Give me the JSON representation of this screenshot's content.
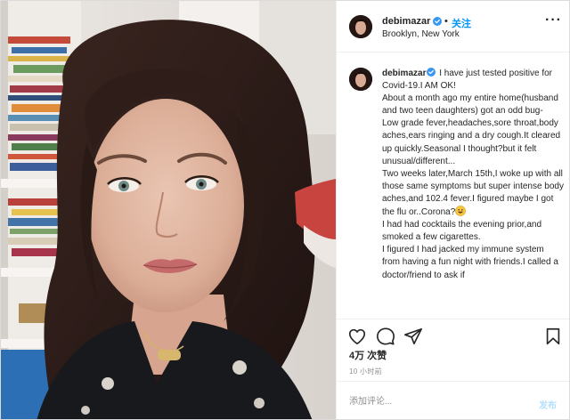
{
  "post": {
    "username": "debimazar",
    "follow_dot": "•",
    "follow_label": "关注",
    "location": "Brooklyn, New York",
    "more_label": "···",
    "caption_lines": [
      "I have just tested positive for Covid-19.I AM OK!",
      "About a month ago my entire home(husband and two teen daughters) got an odd bug-",
      "Low grade fever,headaches,sore throat,body aches,ears ringing and a dry cough.It cleared up quickly.Seasonal I thought?but it felt unusual/different...",
      "Two weeks later,March 15th,I woke up with all those same symptoms but super intense body aches,and 102.4 fever.I figured maybe I got the flu or..Corona?",
      "I had had cocktails the evening prior,and smoked a few cigarettes.",
      "I figured I had jacked my immune system from having a fun night with friends.I called a doctor/friend to ask if"
    ],
    "likes": "4万 次赞",
    "timestamp": "10 小时前",
    "comment_placeholder": "添加评论...",
    "post_label": "发布"
  },
  "icons": {
    "verified": "verified-badge-icon",
    "like": "heart-icon",
    "comment": "speech-bubble-icon",
    "share": "paper-plane-icon",
    "save": "bookmark-icon",
    "emoji": "grinning-face-emoji"
  },
  "colors": {
    "accent": "#0095f6",
    "post_disabled": "#b2dffc",
    "muted": "#8e8e8e",
    "border": "#efefef"
  }
}
